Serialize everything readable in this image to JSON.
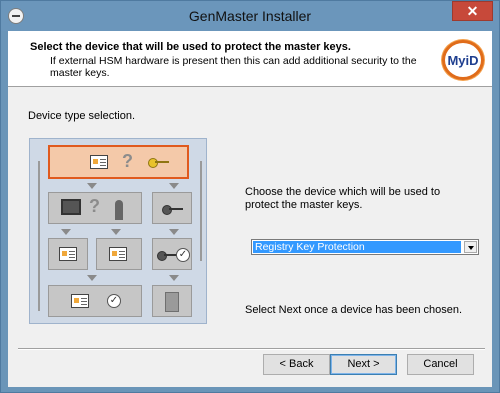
{
  "window": {
    "title": "GenMaster Installer",
    "close_label": "✕",
    "accent_color": "#6b96bb"
  },
  "header": {
    "title": "Select the device that will be used to protect the master keys.",
    "subtitle": "If external HSM hardware is present then this can add additional security to the master keys.",
    "logo_text": "MyiD"
  },
  "main": {
    "section_label": "Device type selection.",
    "description": "Choose the device which will be used to protect the master keys.",
    "device_select": {
      "selected": "Registry Key Protection"
    },
    "hint": "Select Next once a device has been chosen."
  },
  "diagram": {
    "icons": [
      "card-icon",
      "question-icon",
      "key-icon",
      "monitor-icon",
      "person-icon",
      "check-icon",
      "hsm-icon"
    ]
  },
  "buttons": {
    "back": "< Back",
    "next": "Next >",
    "cancel": "Cancel"
  }
}
